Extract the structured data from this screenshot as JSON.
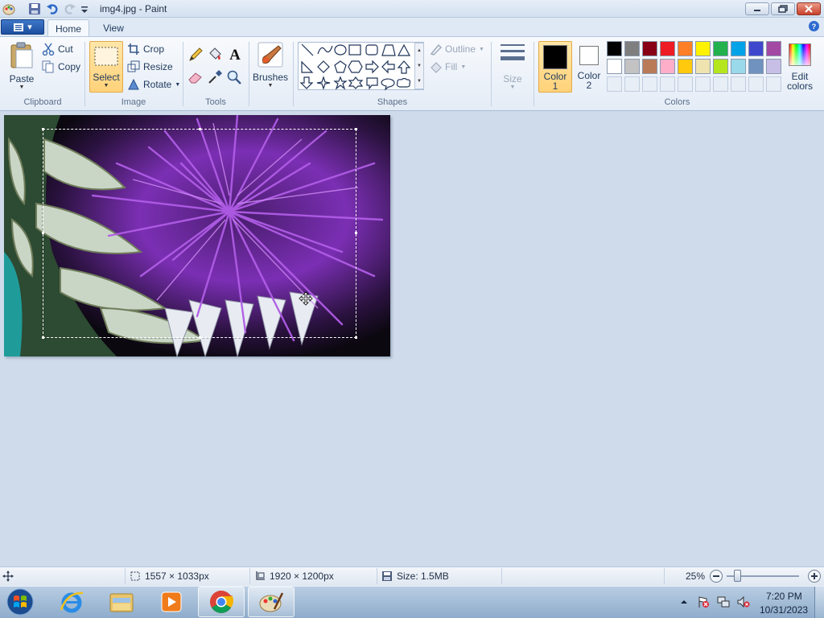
{
  "window": {
    "title": "img4.jpg - Paint",
    "controls": {
      "minimize": "—",
      "maximize": "❐",
      "close": "✕"
    }
  },
  "tabs": {
    "file": "▾",
    "home": "Home",
    "view": "View",
    "help": "?"
  },
  "ribbon": {
    "clipboard": {
      "paste": "Paste",
      "cut": "Cut",
      "copy": "Copy",
      "group": "Clipboard"
    },
    "image": {
      "select": "Select",
      "crop": "Crop",
      "resize": "Resize",
      "rotate": "Rotate",
      "group": "Image"
    },
    "tools": {
      "group": "Tools",
      "text_tool": "A"
    },
    "brushes": {
      "label": "Brushes"
    },
    "shapes": {
      "outline": "Outline",
      "fill": "Fill",
      "group": "Shapes"
    },
    "size": {
      "label": "Size"
    },
    "colors": {
      "color1": "Color",
      "color1_num": "1",
      "color2": "Color",
      "color2_num": "2",
      "edit_colors": "Edit",
      "edit_colors_2": "colors",
      "group": "Colors",
      "palette_row1": [
        "#000000",
        "#7f7f7f",
        "#880015",
        "#ed1c24",
        "#ff7f27",
        "#fff200",
        "#22b14c",
        "#00a2e8",
        "#3f48cc",
        "#a349a4"
      ],
      "palette_row2": [
        "#ffffff",
        "#c3c3c3",
        "#b97a57",
        "#ffaec9",
        "#ffc90e",
        "#efe4b0",
        "#b5e61d",
        "#99d9ea",
        "#7092be",
        "#c8bfe7"
      ]
    }
  },
  "statusbar": {
    "selection_size": "1557 × 1033px",
    "image_size": "1920 × 1200px",
    "file_size": "Size: 1.5MB",
    "zoom": "25%"
  },
  "taskbar": {
    "time": "7:20 PM",
    "date": "10/31/2023"
  }
}
